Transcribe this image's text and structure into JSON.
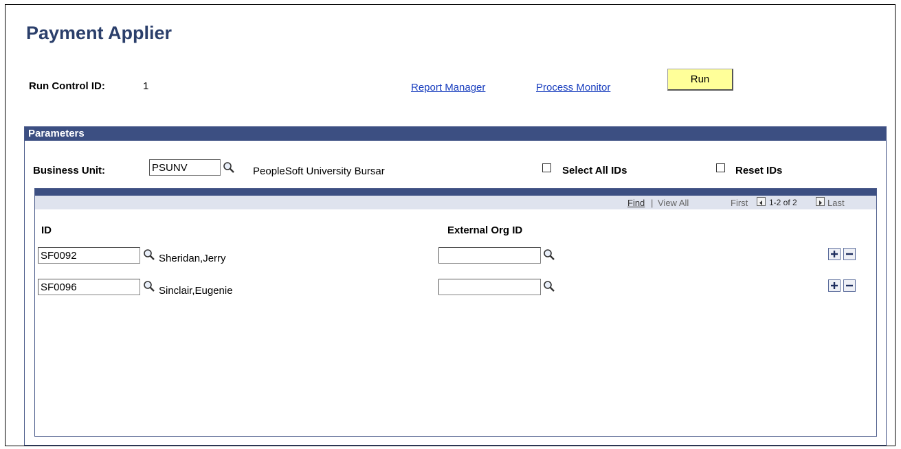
{
  "page": {
    "title": "Payment Applier"
  },
  "run_control": {
    "label": "Run Control ID:",
    "value": "1",
    "report_manager": "Report Manager",
    "process_monitor": "Process Monitor",
    "run_label": "Run"
  },
  "parameters": {
    "header": "Parameters",
    "business_unit_label": "Business Unit:",
    "business_unit_value": "PSUNV",
    "business_unit_desc": "PeopleSoft University Bursar",
    "select_all_label": "Select All IDs",
    "reset_ids_label": "Reset IDs"
  },
  "grid": {
    "find": "Find",
    "separator": "|",
    "view_all": "View All",
    "first": "First",
    "range": "1-2 of 2",
    "last": "Last",
    "col_id": "ID",
    "col_ext": "External Org ID",
    "rows": [
      {
        "id": "SF0092",
        "name": "Sheridan,Jerry",
        "ext": ""
      },
      {
        "id": "SF0096",
        "name": "Sinclair,Eugenie",
        "ext": ""
      }
    ]
  },
  "icons": {
    "lookup": "magnifier-icon",
    "add": "plus-icon",
    "delete": "minus-icon",
    "prev": "left-arrow-icon",
    "next": "right-arrow-icon"
  }
}
